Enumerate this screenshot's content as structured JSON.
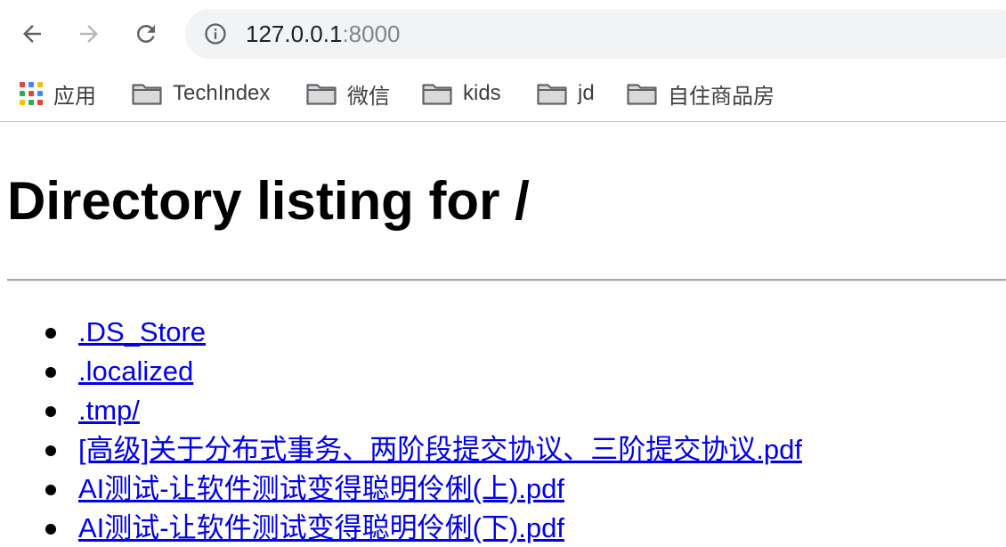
{
  "toolbar": {
    "back_icon": "back-arrow-icon",
    "forward_icon": "forward-arrow-icon",
    "reload_icon": "reload-icon",
    "url_host": "127.0.0.1",
    "url_port": ":8000"
  },
  "bookmarks": [
    {
      "label": "应用",
      "icon": "apps-grid-icon"
    },
    {
      "label": "TechIndex",
      "icon": "folder-icon"
    },
    {
      "label": "微信",
      "icon": "folder-icon"
    },
    {
      "label": "kids",
      "icon": "folder-icon"
    },
    {
      "label": "jd",
      "icon": "folder-icon"
    },
    {
      "label": "自住商品房",
      "icon": "folder-icon"
    }
  ],
  "page": {
    "title": "Directory listing for /",
    "files": [
      ".DS_Store",
      ".localized",
      ".tmp/",
      "[高级]关于分布式事务、两阶段提交协议、三阶提交协议.pdf",
      "AI测试-让软件测试变得聪明伶俐(上).pdf",
      "AI测试-让软件测试变得聪明伶俐(下).pdf"
    ]
  },
  "colors": {
    "link": "#0000ee",
    "omnibox_bg": "#f1f3f4",
    "apps_grid": [
      "#ea4335",
      "#4285f4",
      "#fbbc05",
      "#34a853",
      "#ea4335",
      "#4285f4",
      "#fbbc05",
      "#34a853",
      "#ea4335"
    ]
  }
}
